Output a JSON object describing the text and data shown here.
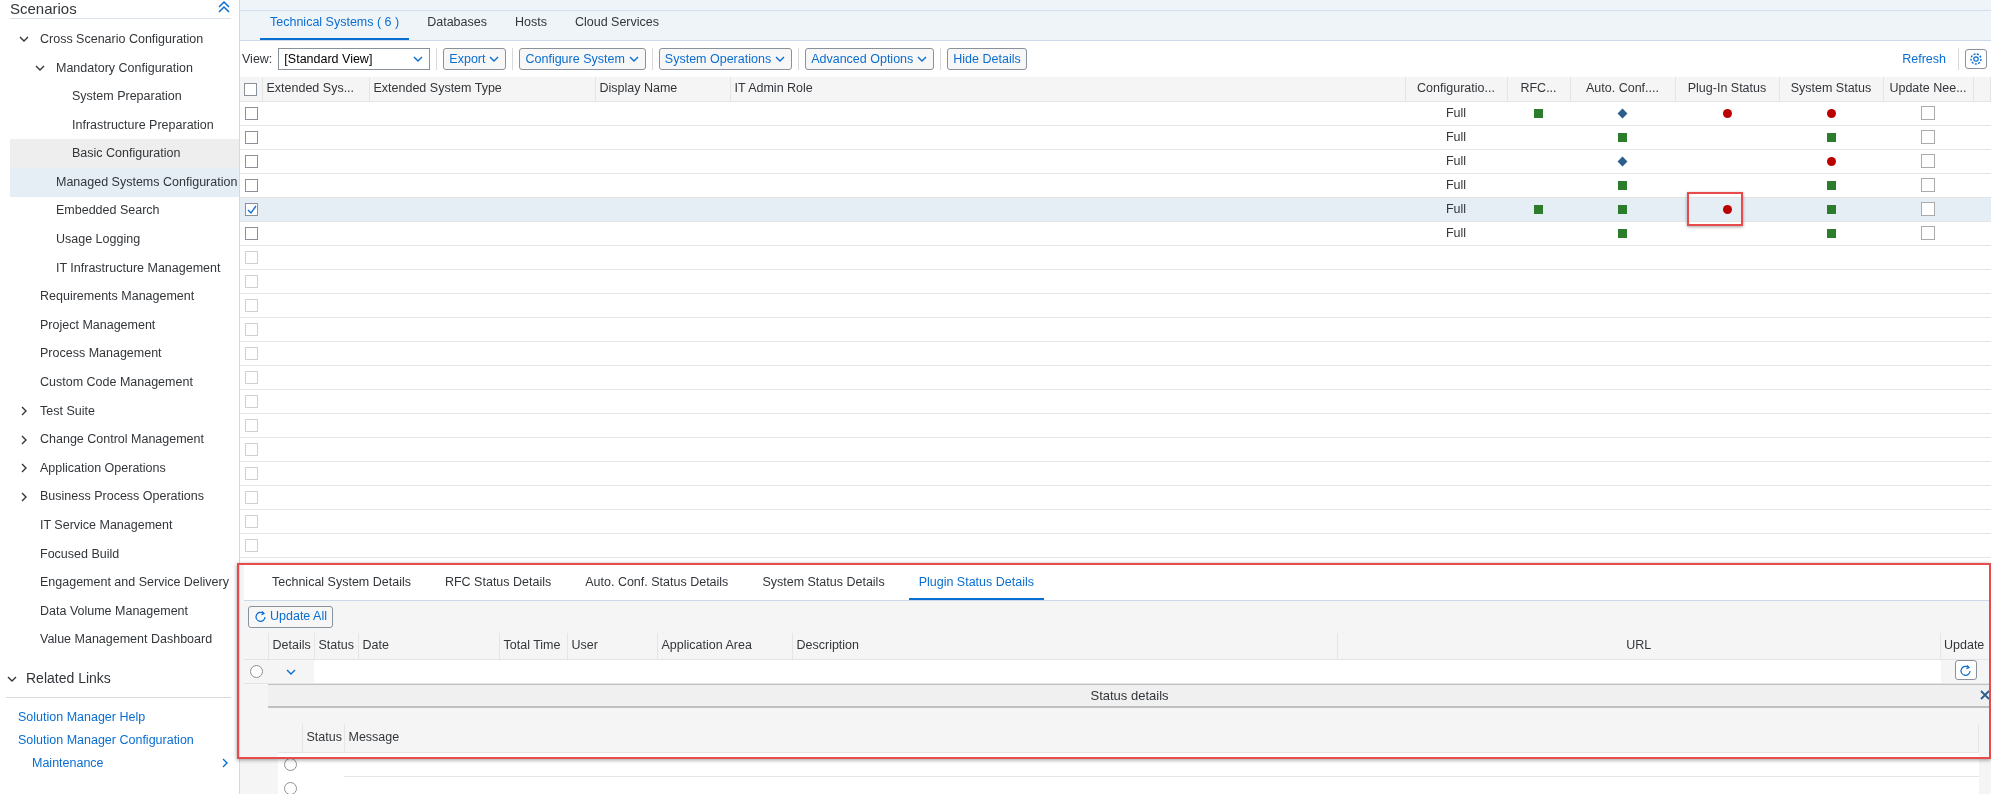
{
  "sidebar": {
    "title": "Scenarios",
    "tree": [
      {
        "label": "Cross Scenario Configuration",
        "expanded": true,
        "selected": false,
        "hovered": false,
        "children": [
          {
            "label": "Mandatory Configuration",
            "expanded": true,
            "selected": false,
            "hovered": false,
            "children": [
              {
                "label": "System Preparation",
                "selected": false,
                "hovered": false
              },
              {
                "label": "Infrastructure Preparation",
                "selected": false,
                "hovered": false
              },
              {
                "label": "Basic Configuration",
                "selected": false,
                "hovered": true
              }
            ]
          },
          {
            "label": "Managed Systems Configuration",
            "selected": true,
            "hovered": false
          },
          {
            "label": "Embedded Search",
            "selected": false,
            "hovered": false
          },
          {
            "label": "Usage Logging",
            "selected": false,
            "hovered": false
          },
          {
            "label": "IT Infrastructure Management",
            "selected": false,
            "hovered": false
          }
        ]
      },
      {
        "label": "Requirements Management",
        "selected": false,
        "hovered": false
      },
      {
        "label": "Project Management",
        "selected": false,
        "hovered": false
      },
      {
        "label": "Process Management",
        "selected": false,
        "hovered": false
      },
      {
        "label": "Custom Code Management",
        "selected": false,
        "hovered": false
      },
      {
        "label": "Test Suite",
        "expanded": false,
        "selected": false,
        "hovered": false
      },
      {
        "label": "Change Control Management",
        "expanded": false,
        "selected": false,
        "hovered": false
      },
      {
        "label": "Application Operations",
        "expanded": false,
        "selected": false,
        "hovered": false
      },
      {
        "label": "Business Process Operations",
        "expanded": false,
        "selected": false,
        "hovered": false
      },
      {
        "label": "IT Service Management",
        "selected": false,
        "hovered": false
      },
      {
        "label": "Focused Build",
        "selected": false,
        "hovered": false
      },
      {
        "label": "Engagement and Service Delivery",
        "selected": false,
        "hovered": false
      },
      {
        "label": "Data Volume Management",
        "selected": false,
        "hovered": false
      },
      {
        "label": "Value Management Dashboard",
        "selected": false,
        "hovered": false
      }
    ],
    "related_links": {
      "title": "Related Links",
      "expanded": true,
      "links": [
        {
          "label": "Solution Manager Help",
          "kind": "link"
        },
        {
          "label": "Solution Manager Configuration",
          "kind": "link"
        },
        {
          "label": "Maintenance",
          "kind": "submenu"
        }
      ]
    }
  },
  "tabs": [
    {
      "label": "Technical Systems ( 6 )",
      "selected": true
    },
    {
      "label": "Databases",
      "selected": false
    },
    {
      "label": "Hosts",
      "selected": false
    },
    {
      "label": "Cloud Services",
      "selected": false
    }
  ],
  "toolbar": {
    "view_label": "View:",
    "view_value": "[Standard View]",
    "menus": [
      "Export",
      "Configure System",
      "System Operations",
      "Advanced Options"
    ],
    "buttons": [
      "Hide Details"
    ],
    "refresh": "Refresh"
  },
  "table": {
    "columns": [
      "Extended Sys...",
      "Extended System Type",
      "Display Name",
      "IT Admin Role",
      "Configuratio...",
      "RFC...",
      "Auto. Conf....",
      "Plug-In Status",
      "System Status",
      "Update Nee..."
    ],
    "all_selected": false,
    "rows": [
      {
        "selected": false,
        "configuration": "Full",
        "statuses": [
          {
            "kind": "square",
            "color": "#2b7c2b"
          },
          {
            "kind": "diamond",
            "color": "#2b5e8c"
          },
          {
            "kind": "dot",
            "color": "#bb0000"
          },
          {
            "kind": "dot",
            "color": "#bb0000"
          }
        ],
        "update_needed": false,
        "plugin_highlighted": false
      },
      {
        "selected": false,
        "configuration": "Full",
        "statuses": [
          {
            "kind": "blank"
          },
          {
            "kind": "square",
            "color": "#2b7c2b"
          },
          {
            "kind": "blank"
          },
          {
            "kind": "square",
            "color": "#2b7c2b"
          }
        ],
        "update_needed": false,
        "plugin_highlighted": false
      },
      {
        "selected": false,
        "configuration": "Full",
        "statuses": [
          {
            "kind": "blank"
          },
          {
            "kind": "diamond",
            "color": "#2b5e8c"
          },
          {
            "kind": "blank"
          },
          {
            "kind": "dot",
            "color": "#bb0000"
          }
        ],
        "update_needed": false,
        "plugin_highlighted": false
      },
      {
        "selected": false,
        "configuration": "Full",
        "statuses": [
          {
            "kind": "blank"
          },
          {
            "kind": "square",
            "color": "#2b7c2b"
          },
          {
            "kind": "blank"
          },
          {
            "kind": "square",
            "color": "#2b7c2b"
          }
        ],
        "update_needed": false,
        "plugin_highlighted": false
      },
      {
        "selected": true,
        "configuration": "Full",
        "statuses": [
          {
            "kind": "square",
            "color": "#2b7c2b"
          },
          {
            "kind": "square",
            "color": "#2b7c2b"
          },
          {
            "kind": "dot",
            "color": "#bb0000"
          },
          {
            "kind": "square",
            "color": "#2b7c2b"
          }
        ],
        "update_needed": false,
        "plugin_highlighted": true
      },
      {
        "selected": false,
        "configuration": "Full",
        "statuses": [
          {
            "kind": "blank"
          },
          {
            "kind": "square",
            "color": "#2b7c2b"
          },
          {
            "kind": "blank"
          },
          {
            "kind": "square",
            "color": "#2b7c2b"
          }
        ],
        "update_needed": false,
        "plugin_highlighted": false
      }
    ],
    "empty_rows": [
      {
        "selected": false
      },
      {
        "selected": false
      },
      {
        "selected": false
      },
      {
        "selected": false
      },
      {
        "selected": false
      },
      {
        "selected": false
      },
      {
        "selected": false
      },
      {
        "selected": false
      },
      {
        "selected": false
      },
      {
        "selected": false
      },
      {
        "selected": false
      },
      {
        "selected": false
      },
      {
        "selected": false
      }
    ]
  },
  "details": {
    "highlighted": true,
    "tabs": [
      {
        "label": "Technical System Details",
        "selected": false
      },
      {
        "label": "RFC Status Details",
        "selected": false
      },
      {
        "label": "Auto. Conf. Status Details",
        "selected": false
      },
      {
        "label": "System Status Details",
        "selected": false
      },
      {
        "label": "Plugin Status Details",
        "selected": true
      }
    ],
    "update_all": "Update All",
    "columns": [
      "Details",
      "Status",
      "Date",
      "Total Time",
      "User",
      "Application Area",
      "Description",
      "URL",
      "Update"
    ],
    "row": {
      "selected": false,
      "expanded": true
    },
    "status_details": {
      "title": "Status details",
      "columns": [
        "Status",
        "Message"
      ],
      "rows": [
        {
          "selected": false
        },
        {
          "selected": false
        }
      ]
    }
  }
}
